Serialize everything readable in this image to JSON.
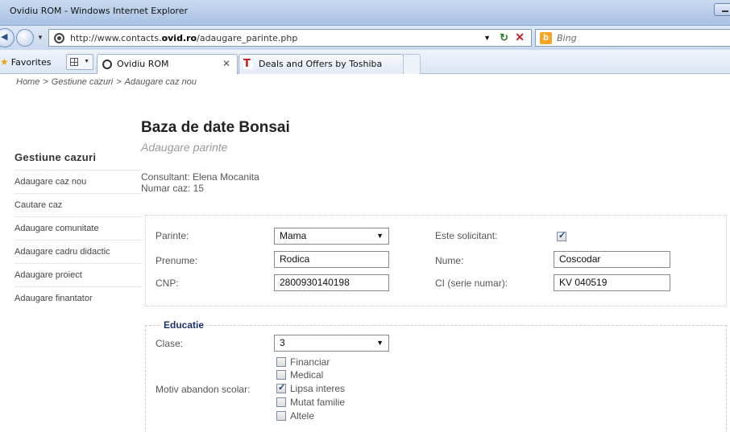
{
  "browser": {
    "window_title": "Ovidiu ROM - Windows Internet Explorer",
    "url_prefix": "http://www.contacts.",
    "url_domain": "ovid.ro",
    "url_path": "/adaugare_parinte.php",
    "search_placeholder": "Bing",
    "favorites_label": "Favorites",
    "tabs": [
      {
        "label": "Ovidiu ROM",
        "active": true
      },
      {
        "label": "Deals and Offers by Toshiba",
        "active": false
      }
    ]
  },
  "breadcrumb": {
    "home": "Home",
    "sep": ">",
    "section": "Gestiune cazuri",
    "current": "Adaugare caz nou"
  },
  "sidebar": {
    "title": "Gestiune cazuri",
    "items": [
      {
        "label": "Adaugare caz nou"
      },
      {
        "label": "Cautare caz"
      },
      {
        "label": "Adaugare comunitate"
      },
      {
        "label": "Adaugare cadru didactic"
      },
      {
        "label": "Adaugare proiect"
      },
      {
        "label": "Adaugare finantator"
      }
    ]
  },
  "page": {
    "title": "Baza de date Bonsai",
    "subtitle": "Adaugare parinte",
    "consultant": "Consultant: Elena Mocanita",
    "case_number": "Numar caz: 15"
  },
  "form": {
    "parinte_label": "Parinte:",
    "parinte_value": "Mama",
    "solicitant_label": "Este solicitant:",
    "solicitant_checked": true,
    "prenume_label": "Prenume:",
    "prenume_value": "Rodica",
    "nume_label": "Nume:",
    "nume_value": "Coscodar",
    "cnp_label": "CNP:",
    "cnp_value": "2800930140198",
    "ci_label": "CI (serie numar):",
    "ci_value": "KV 040519"
  },
  "educatie": {
    "legend": "Educatie",
    "clase_label": "Clase:",
    "clase_value": "3",
    "motiv_label": "Motiv abandon scolar:",
    "options": [
      {
        "label": "Financiar",
        "checked": false
      },
      {
        "label": "Medical",
        "checked": false
      },
      {
        "label": "Lipsa interes",
        "checked": true
      },
      {
        "label": "Mutat familie",
        "checked": false
      },
      {
        "label": "Altele",
        "checked": false
      }
    ]
  }
}
